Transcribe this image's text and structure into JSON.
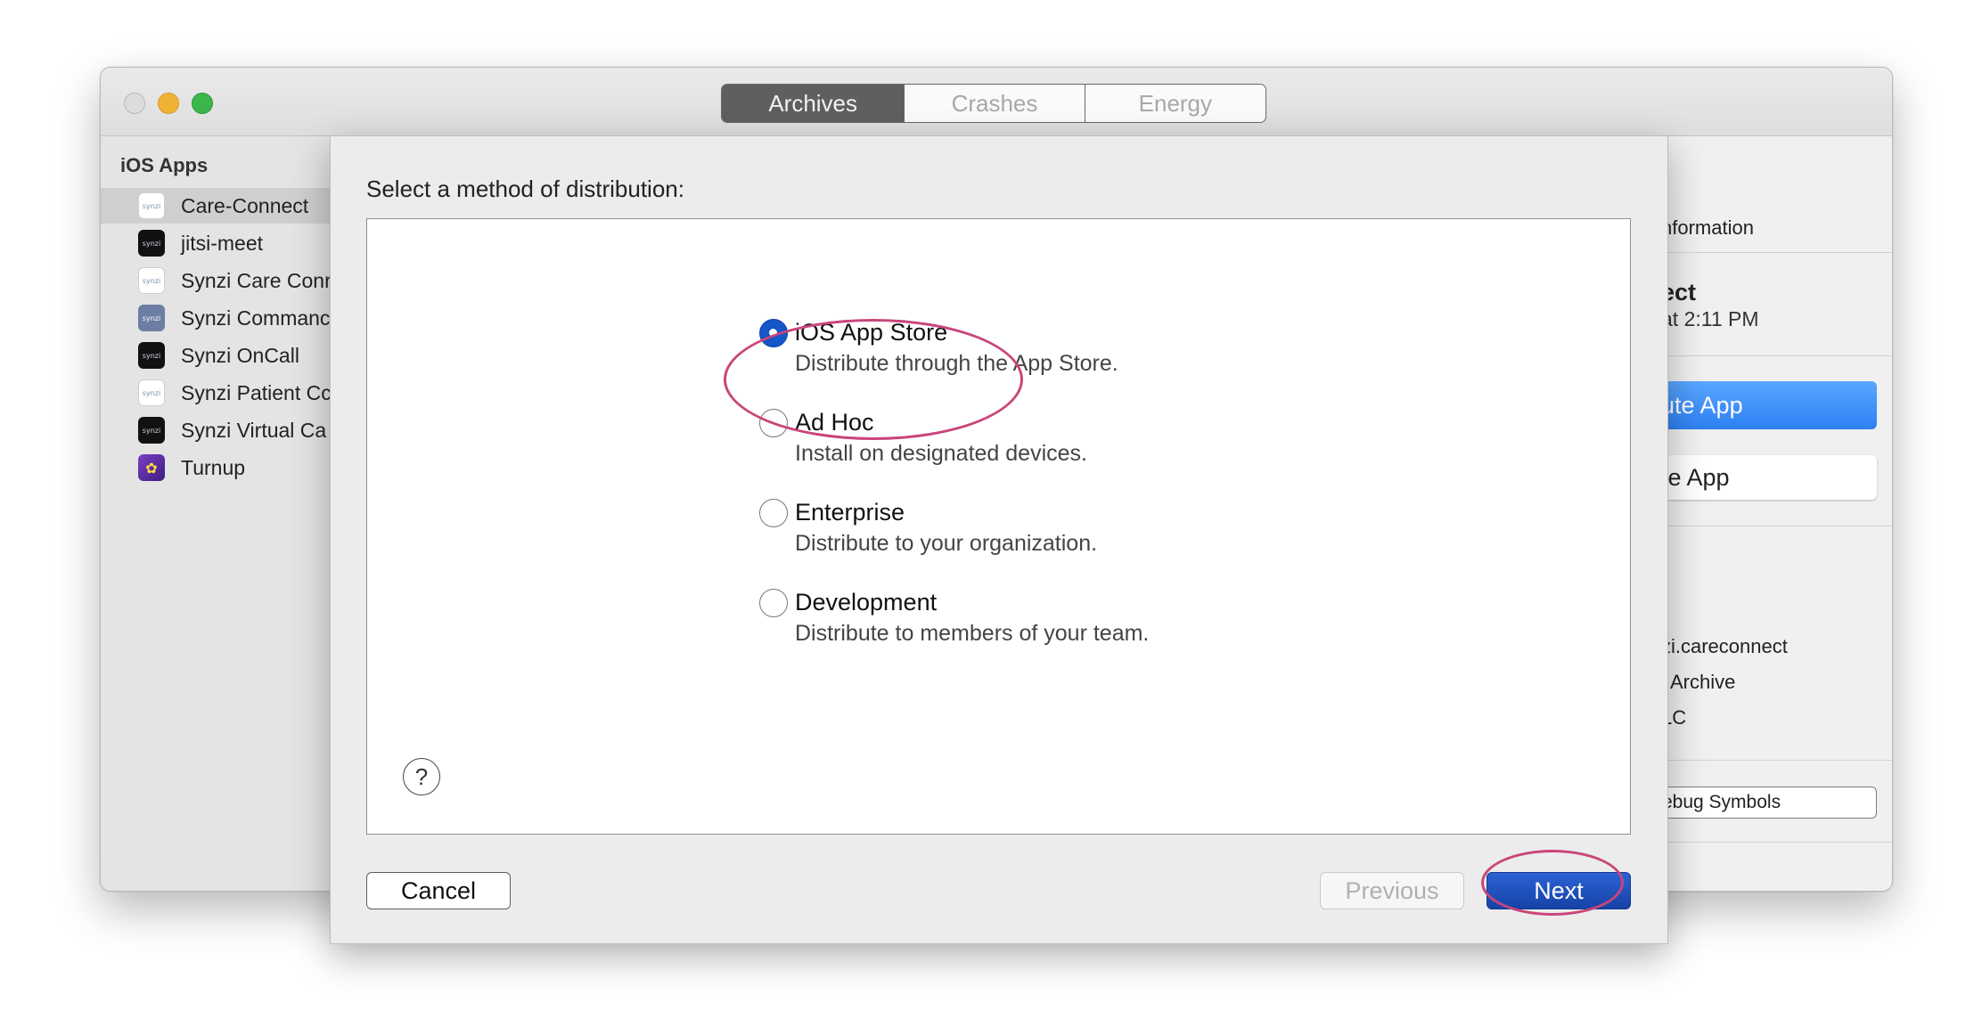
{
  "window": {
    "tabs": [
      {
        "label": "Archives",
        "selected": true
      },
      {
        "label": "Crashes",
        "selected": false
      },
      {
        "label": "Energy",
        "selected": false
      }
    ]
  },
  "sidebar": {
    "header": "iOS Apps",
    "items": [
      {
        "label": "Care-Connect",
        "icon_text": "synzi",
        "selected": true
      },
      {
        "label": "jitsi-meet",
        "icon_text": "synzi"
      },
      {
        "label": "Synzi Care Conr",
        "icon_text": "synzi"
      },
      {
        "label": "Synzi Commanc",
        "icon_text": "synzi"
      },
      {
        "label": "Synzi OnCall",
        "icon_text": "synzi"
      },
      {
        "label": "Synzi Patient Cc",
        "icon_text": "synzi"
      },
      {
        "label": "Synzi Virtual Ca",
        "icon_text": "synzi"
      },
      {
        "label": "Turnup",
        "icon_text": "✿"
      }
    ]
  },
  "inspector": {
    "section_label": "nformation",
    "app_name": "ect",
    "date_text": "at 2:11 PM",
    "distribute_button": "ute App",
    "validate_button": "te App",
    "version_fragment": ")",
    "identifier_fragment": "zi.careconnect",
    "type_fragment": "Archive",
    "team_fragment": "LC",
    "debug_button": "ebug Symbols"
  },
  "sheet": {
    "title": "Select a method of distribution:",
    "options": [
      {
        "title": "iOS App Store",
        "description": "Distribute through the App Store.",
        "checked": true
      },
      {
        "title": "Ad Hoc",
        "description": "Install on designated devices.",
        "checked": false
      },
      {
        "title": "Enterprise",
        "description": "Distribute to your organization.",
        "checked": false
      },
      {
        "title": "Development",
        "description": "Distribute to members of your team.",
        "checked": false
      }
    ],
    "help_symbol": "?",
    "cancel_label": "Cancel",
    "previous_label": "Previous",
    "next_label": "Next"
  },
  "colors": {
    "accent_blue": "#1556c9",
    "annotation_pink": "#c9457a"
  }
}
